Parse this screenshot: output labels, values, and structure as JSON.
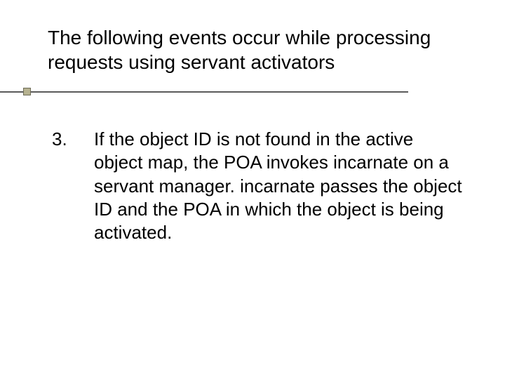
{
  "title": "The following events occur while processing requests using servant activators",
  "list": {
    "items": [
      {
        "number": "3.",
        "text": "If the object ID is not found in the active object map, the POA invokes incarnate on a servant manager. incarnate passes the object ID and the POA in which the object is being activated."
      }
    ]
  }
}
